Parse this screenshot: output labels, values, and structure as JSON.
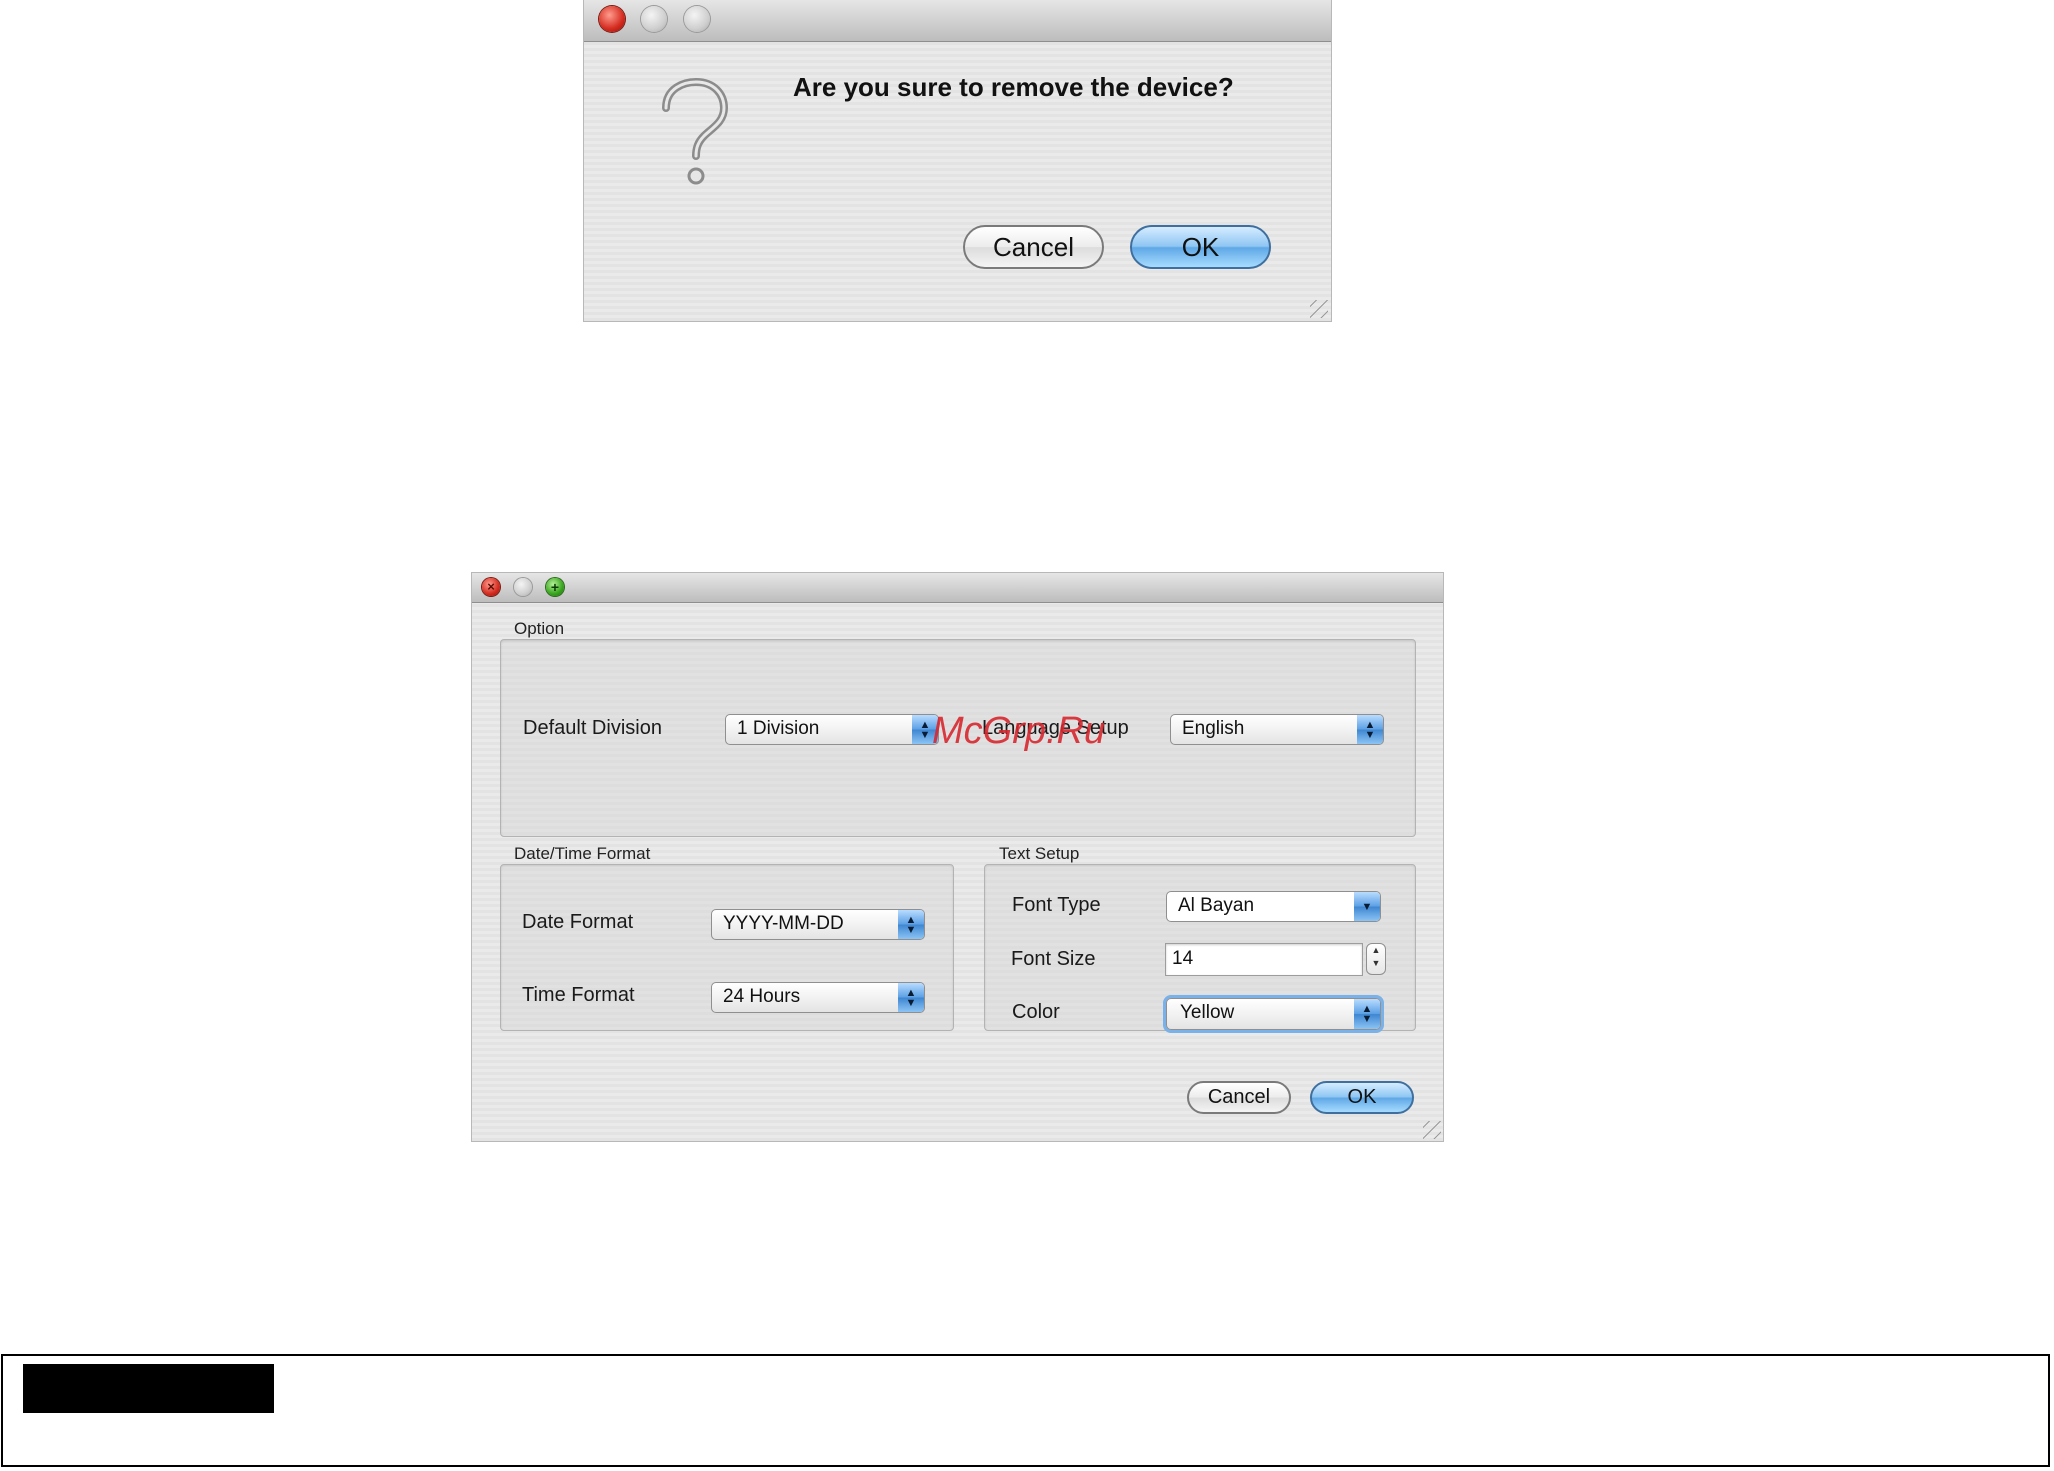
{
  "confirm_dialog": {
    "message": "Are you sure to remove the device?",
    "icon": "question-mark-icon",
    "cancel_label": "Cancel",
    "ok_label": "OK"
  },
  "settings_dialog": {
    "option": {
      "title": "Option",
      "default_division_label": "Default Division",
      "default_division_value": "1 Division",
      "language_label": "Language Setup",
      "language_value": "English"
    },
    "datetime": {
      "title": "Date/Time Format",
      "date_label": "Date Format",
      "date_value": "YYYY-MM-DD",
      "time_label": "Time Format",
      "time_value": "24 Hours"
    },
    "text_setup": {
      "title": "Text Setup",
      "font_type_label": "Font Type",
      "font_type_value": "Al Bayan",
      "font_size_label": "Font Size",
      "font_size_value": "14",
      "color_label": "Color",
      "color_value": "Yellow"
    },
    "cancel_label": "Cancel",
    "ok_label": "OK"
  },
  "watermark": "McGrp.Ru",
  "colors": {
    "watermark": "#d7282f",
    "default_button": "#5fa8e6",
    "close_light": "#d42b1f",
    "zoom_light": "#38a51d"
  }
}
